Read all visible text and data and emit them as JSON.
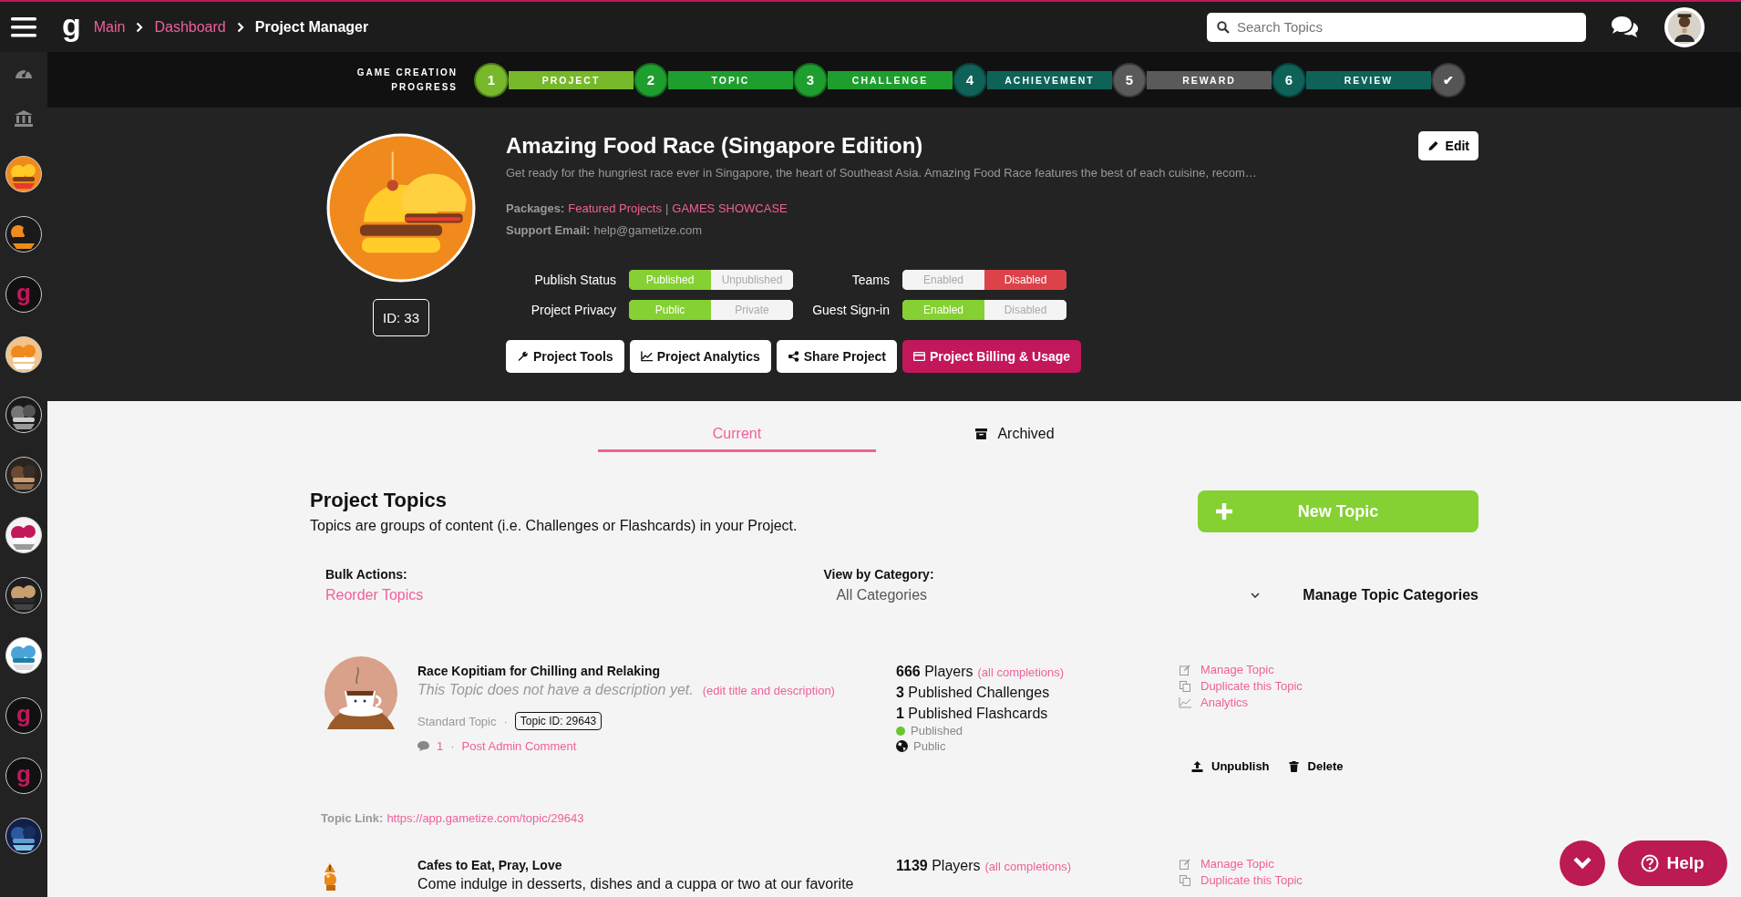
{
  "topbar": {
    "logo": "g",
    "breadcrumbs": [
      {
        "label": "Main",
        "link": true
      },
      {
        "label": "Dashboard",
        "link": true
      },
      {
        "label": "Project Manager",
        "link": false
      }
    ],
    "search": {
      "placeholder": "Search Topics"
    }
  },
  "sidebar": {
    "items": [
      {
        "kind": "picture"
      },
      {
        "kind": "picture"
      },
      {
        "kind": "logo",
        "label": "g"
      },
      {
        "kind": "picture"
      },
      {
        "kind": "picture"
      },
      {
        "kind": "picture"
      },
      {
        "kind": "picture"
      },
      {
        "kind": "picture"
      },
      {
        "kind": "picture"
      },
      {
        "kind": "logo",
        "label": "g"
      },
      {
        "kind": "logo",
        "label": "g"
      },
      {
        "kind": "picture"
      }
    ]
  },
  "progress": {
    "title": "GAME CREATION PROGRESS",
    "steps": [
      {
        "number": "1",
        "label": "PROJECT",
        "color": "#76b82a"
      },
      {
        "number": "2",
        "label": "TOPIC",
        "color": "#1e9e2e"
      },
      {
        "number": "3",
        "label": "CHALLENGE",
        "color": "#1e9e2e"
      },
      {
        "number": "4",
        "label": "ACHIEVEMENT",
        "color": "#0e6258"
      },
      {
        "number": "5",
        "label": "REWARD",
        "color": "#5a5a5a"
      },
      {
        "number": "6",
        "label": "REVIEW",
        "color": "#0e6258"
      }
    ],
    "final": "✔"
  },
  "project": {
    "title": "Amazing Food Race (Singapore Edition)",
    "description": "Get ready for the hungriest race ever in Singapore, the heart of Southeast Asia. Amazing Food Race features the best of each cuisine, recom…",
    "id": "ID: 33",
    "edit": "Edit",
    "packages_label": "Packages:",
    "packages": [
      "Featured Projects",
      "GAMES SHOWCASE"
    ],
    "separator": "|",
    "email_label": "Support Email:",
    "email": "help@gametize.com",
    "toggles": [
      {
        "label": "Publish Status",
        "options": [
          {
            "label": "Published",
            "selected": true
          },
          {
            "label": "Unpublished",
            "selected": false
          }
        ],
        "color": "#85d032"
      },
      {
        "label": "Teams",
        "options": [
          {
            "label": "Enabled",
            "selected": false
          },
          {
            "label": "Disabled",
            "selected": true
          }
        ],
        "color": "#dc4249"
      },
      {
        "label": "Project Privacy",
        "options": [
          {
            "label": "Public",
            "selected": true
          },
          {
            "label": "Private",
            "selected": false
          }
        ],
        "color": "#85d032"
      },
      {
        "label": "Guest Sign-in",
        "options": [
          {
            "label": "Enabled",
            "selected": true
          },
          {
            "label": "Disabled",
            "selected": false
          }
        ],
        "color": "#85d032"
      }
    ],
    "buttons": [
      {
        "label": "Project Tools",
        "kind": "tools"
      },
      {
        "label": "Project Analytics",
        "kind": "analytics"
      },
      {
        "label": "Share Project",
        "kind": "share"
      },
      {
        "label": "Project Billing & Usage",
        "kind": "billing"
      }
    ]
  },
  "tabs": [
    {
      "label": "Current",
      "selected": true
    },
    {
      "label": "Archived",
      "selected": false
    }
  ],
  "topics_section": {
    "title": "Project Topics",
    "subtitle": "Topics are groups of content (i.e. Challenges or Flashcards) in your Project.",
    "new_button": "New Topic",
    "bulk_label": "Bulk Actions:",
    "bulk_link": "Reorder Topics",
    "category_label": "View by Category:",
    "category_value": "All Categories",
    "manage_categories": "Manage Topic Categories"
  },
  "topics": [
    {
      "title": "Race Kopitiam for Chilling and Relaking",
      "description": "This Topic does not have a description yet.",
      "description_empty": true,
      "edit_link": "(edit title and description)",
      "type": "Standard Topic",
      "separator": "·",
      "topic_id": "Topic ID: 29643",
      "comments": "1",
      "comment_link": "Post Admin Comment",
      "stats": [
        "**666** Players",
        "**3** Published Challenges",
        "**1** Published Flashcards"
      ],
      "completions": "(all completions)",
      "status": {
        "label": "Published",
        "color": "#6cc430"
      },
      "privacy": "Public",
      "actions": [
        "Manage Topic",
        "Duplicate this Topic",
        "Analytics"
      ],
      "unpublish": "Unpublish",
      "delete": "Delete",
      "link_label": "Topic Link:",
      "link": "https://app.gametize.com/topic/29643"
    },
    {
      "title": "Cafes to Eat, Pray, Love",
      "description": "Come indulge in desserts, dishes and a cuppa or two at our favorite",
      "description_empty": false,
      "stats": [
        "**1139** Players"
      ],
      "completions": "(all completions)",
      "actions": [
        "Manage Topic",
        "Duplicate this Topic"
      ]
    }
  ],
  "help": {
    "label": "Help"
  }
}
